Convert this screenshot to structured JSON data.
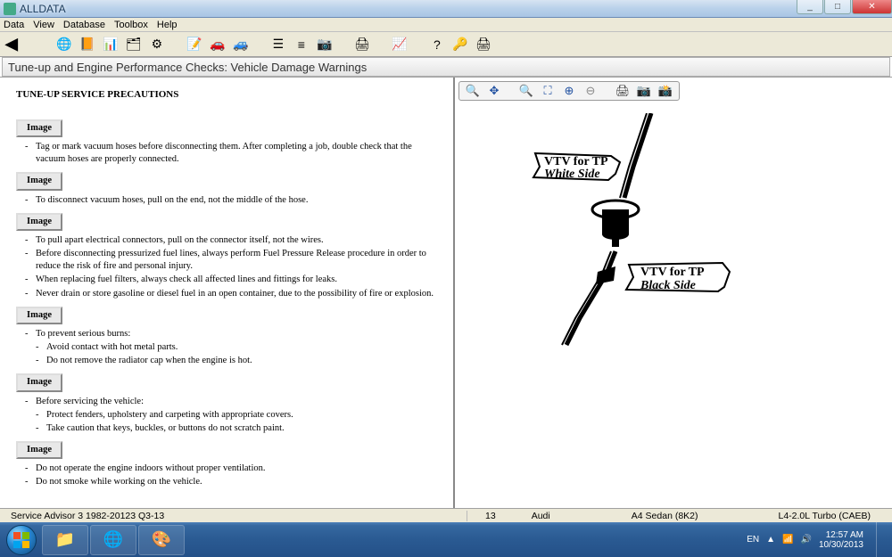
{
  "window": {
    "title": "ALLDATA",
    "controls": {
      "min": "_",
      "max": "□",
      "close": "✕"
    }
  },
  "menubar": [
    "Data",
    "View",
    "Database",
    "Toolbox",
    "Help"
  ],
  "toolbar_icons": [
    {
      "name": "back-icon",
      "glyph": "◀"
    },
    {
      "name": "globe-icon",
      "glyph": "🌐"
    },
    {
      "name": "book-icon",
      "glyph": "📙"
    },
    {
      "name": "table-icon",
      "glyph": "📊"
    },
    {
      "name": "cards-icon",
      "glyph": "🗂"
    },
    {
      "name": "gear-icon",
      "glyph": "⚙"
    },
    {
      "name": "note-icon",
      "glyph": "📝"
    },
    {
      "name": "newcar-icon",
      "glyph": "🚗"
    },
    {
      "name": "car-icon",
      "glyph": "🚙"
    },
    {
      "name": "list-icon",
      "glyph": "☰"
    },
    {
      "name": "lines-icon",
      "glyph": "≡"
    },
    {
      "name": "camera-icon",
      "glyph": "📷"
    },
    {
      "name": "print-icon",
      "glyph": "🖨"
    },
    {
      "name": "chart-icon",
      "glyph": "📈"
    },
    {
      "name": "help-icon",
      "glyph": "?"
    },
    {
      "name": "key-icon",
      "glyph": "🔑"
    },
    {
      "name": "printer2-icon",
      "glyph": "🖨"
    }
  ],
  "breadcrumb": "Tune-up and Engine Performance Checks:  Vehicle Damage Warnings",
  "article": {
    "heading": "TUNE-UP SERVICE PRECAUTIONS",
    "image_btn_label": "Image",
    "sections": [
      {
        "items": [
          "Tag or mark vacuum hoses before disconnecting them. After completing a job, double check that the vacuum hoses are properly connected."
        ]
      },
      {
        "items": [
          "To disconnect vacuum hoses, pull on the end, not the middle of the hose."
        ]
      },
      {
        "items": [
          "To pull apart electrical connectors, pull on the connector itself, not the wires.",
          "Before disconnecting pressurized fuel lines, always perform Fuel Pressure Release procedure in order to reduce the risk of fire and personal injury.",
          "When replacing fuel filters, always check all affected lines and fittings for leaks.",
          "Never drain or store gasoline or diesel fuel in an open container, due to the possibility of fire or explosion."
        ]
      },
      {
        "items": [
          "To prevent serious burns:"
        ],
        "subitems": [
          "Avoid contact with hot metal parts.",
          "Do not remove the radiator cap when the engine is hot."
        ]
      },
      {
        "items": [
          "Before servicing the vehicle:"
        ],
        "subitems": [
          "Protect fenders, upholstery and carpeting with appropriate covers.",
          "Take caution that keys, buckles, or buttons do not scratch paint."
        ]
      },
      {
        "items": [
          "Do not operate the engine indoors without proper ventilation.",
          "Do not smoke while working on the vehicle."
        ]
      }
    ]
  },
  "image_toolbar_icons": [
    {
      "name": "zoom-in-icon",
      "glyph": "🔍"
    },
    {
      "name": "move-icon",
      "glyph": "✥"
    },
    {
      "name": "zoom-region-icon",
      "glyph": "🔍"
    },
    {
      "name": "zoom-fit-icon",
      "glyph": "⛶"
    },
    {
      "name": "zoom-plus-icon",
      "glyph": "⊕"
    },
    {
      "name": "zoom-minus-icon",
      "glyph": "⊖"
    },
    {
      "name": "print-img-icon",
      "glyph": "🖨"
    },
    {
      "name": "camera2-icon",
      "glyph": "📷"
    },
    {
      "name": "camera3-icon",
      "glyph": "📸"
    }
  ],
  "diagram": {
    "label_top_line1": "VTV for TP",
    "label_top_line2": "White Side",
    "label_bot_line1": "VTV for TP",
    "label_bot_line2": "Black Side"
  },
  "statusbar": {
    "advisor": "Service Advisor 3 1982-20123 Q3-13",
    "page": "13",
    "make": "Audi",
    "model": "A4 Sedan (8K2)",
    "engine": "L4-2.0L Turbo (CAEB)"
  },
  "tray": {
    "lang": "EN",
    "time": "12:57 AM",
    "date": "10/30/2013"
  }
}
